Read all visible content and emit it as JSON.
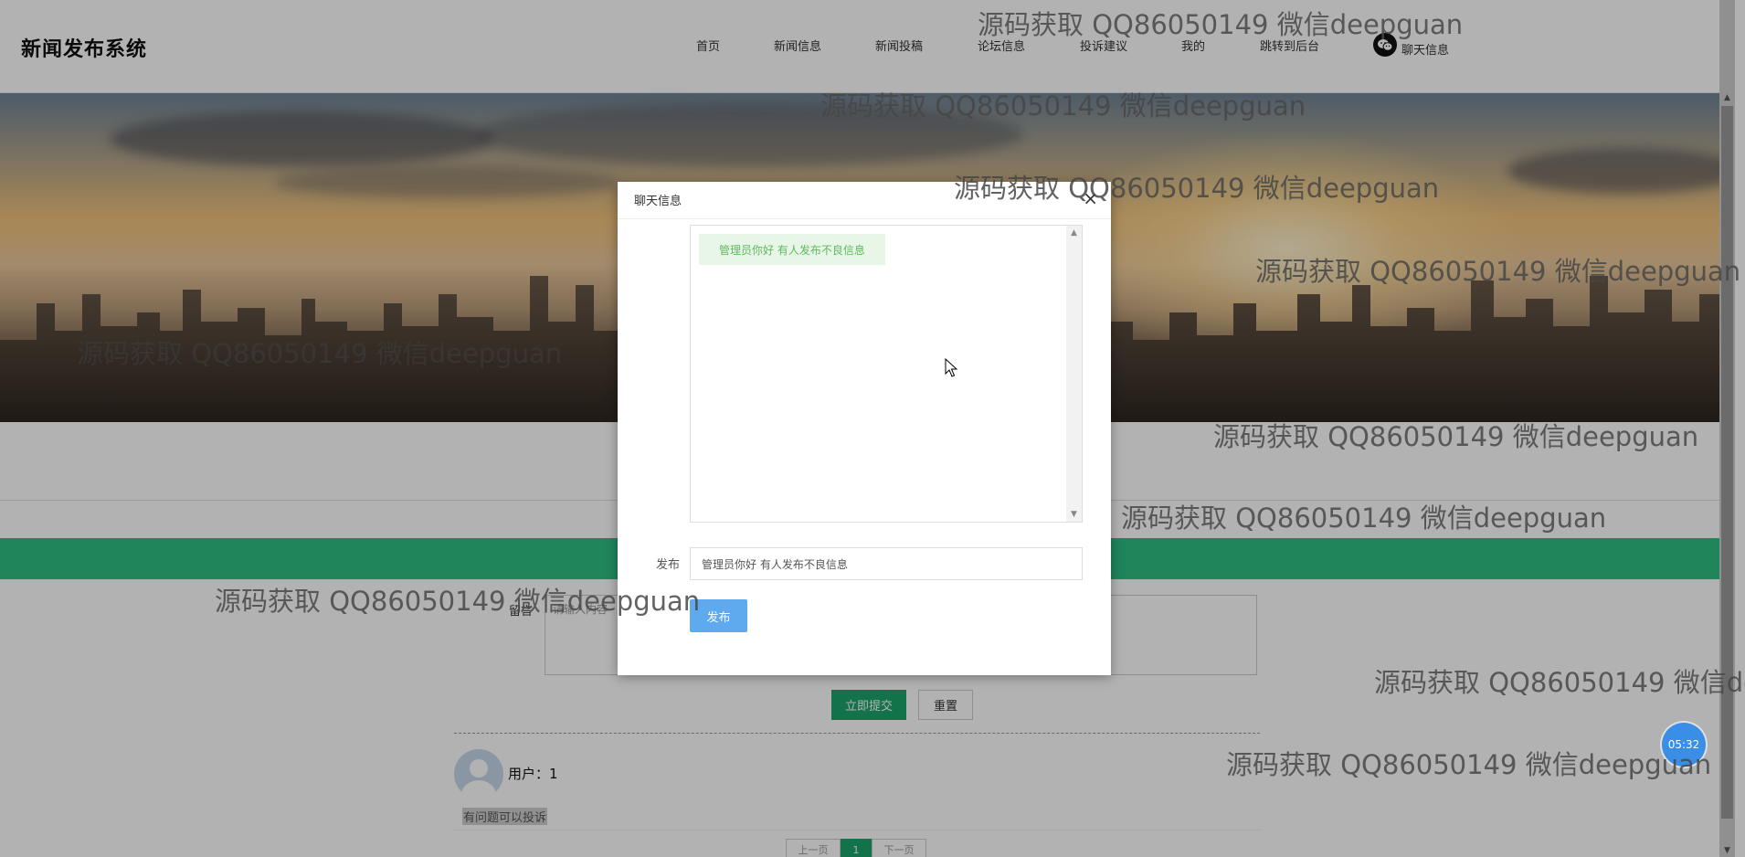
{
  "header": {
    "site_title": "新闻发布系统",
    "nav": [
      "首页",
      "新闻信息",
      "新闻投稿",
      "论坛信息",
      "投诉建议",
      "我的",
      "跳转到后台"
    ],
    "chat_nav_label": "聊天信息"
  },
  "message_form": {
    "label": "留言",
    "placeholder": "请输入内容",
    "submit_label": "立即提交",
    "reset_label": "重置"
  },
  "comment": {
    "user": "用户：1",
    "text": "有问题可以投诉"
  },
  "pager": {
    "prev": "上一页",
    "current": "1",
    "next": "下一页"
  },
  "chat_modal": {
    "title": "聊天信息",
    "close": "×",
    "messages": [
      "管理员你好 有人发布不良信息"
    ],
    "post_label": "发布",
    "input_value": "管理员你好 有人发布不良信息",
    "send_label": "发布"
  },
  "timer": "05:32",
  "watermark_text": "源码获取 QQ86050149 微信deepguan",
  "colors": {
    "accent_green": "#2fbf83",
    "submit_green": "#1aa46b",
    "send_blue": "#5fa9ef",
    "bubble_text": "#5fb85f",
    "timer_blue": "#3a8ee6"
  },
  "icons": [
    "wechat-icon",
    "close-icon",
    "user-avatar-icon",
    "mouse-cursor-icon"
  ]
}
